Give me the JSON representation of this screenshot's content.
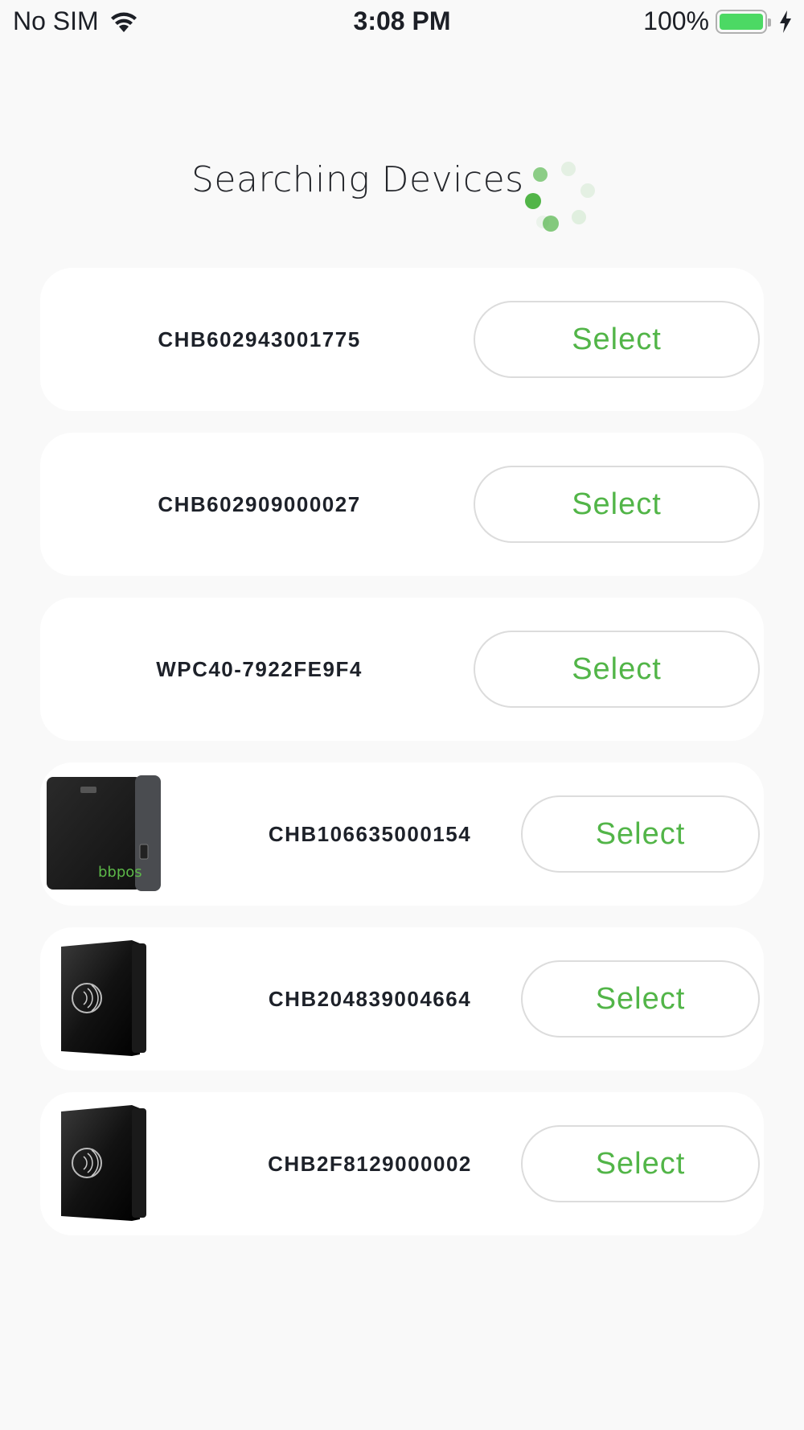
{
  "status_bar": {
    "carrier": "No SIM",
    "time": "3:08 PM",
    "battery_percent": "100%",
    "icons": [
      "wifi-icon",
      "battery-icon",
      "charging-bolt-icon"
    ],
    "battery_color": "#4cd964"
  },
  "header": {
    "title": "Searching Devices",
    "spinner_icon": "loading-spinner-icon",
    "accent_color": "#52b548"
  },
  "devices": [
    {
      "name": "CHB602943001775",
      "select_label": "Select",
      "image": null
    },
    {
      "name": "CHB602909000027",
      "select_label": "Select",
      "image": null
    },
    {
      "name": "WPC40-7922FE9F4",
      "select_label": "Select",
      "image": null
    },
    {
      "name": "CHB106635000154",
      "select_label": "Select",
      "image": "bbpos-card-reader"
    },
    {
      "name": "CHB204839004664",
      "select_label": "Select",
      "image": "contactless-card-reader"
    },
    {
      "name": "CHB2F8129000002",
      "select_label": "Select",
      "image": "contactless-card-reader"
    }
  ],
  "thumb_brand": "bbpos"
}
